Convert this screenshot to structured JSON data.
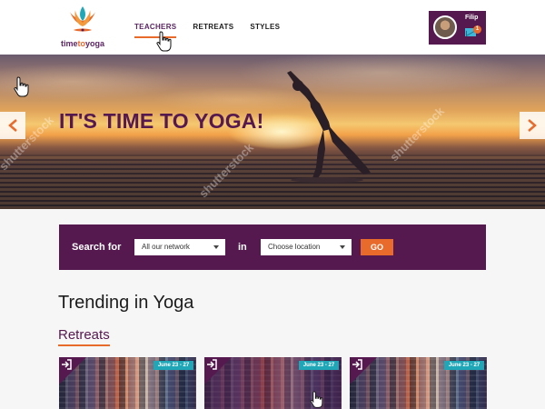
{
  "brand": {
    "logo_text_prefix": "time",
    "logo_text_mid": "to",
    "logo_text_suffix": "yoga",
    "primary_color": "#55194f",
    "accent_color": "#e86b2c",
    "teal_color": "#1fa7b8"
  },
  "nav": {
    "items": [
      {
        "label": "TEACHERS",
        "active": true
      },
      {
        "label": "RETREATS",
        "active": false
      },
      {
        "label": "STYLES",
        "active": false
      }
    ]
  },
  "user": {
    "name": "Filip",
    "mail_count": "1",
    "avatar_icon": "user-avatar",
    "mail_icon": "envelope-icon"
  },
  "hero": {
    "title": "IT'S TIME TO YOGA!",
    "prev_icon": "chevron-left-icon",
    "next_icon": "chevron-right-icon"
  },
  "search": {
    "label": "Search for",
    "network_value": "All our network",
    "in_label": "in",
    "location_placeholder": "Choose location",
    "go_label": "GO"
  },
  "trending": {
    "title": "Trending in Yoga",
    "section_label": "Retreats",
    "cards": [
      {
        "date": "June 23 - 27",
        "icon": "sign-in-icon"
      },
      {
        "date": "June 23 - 27",
        "icon": "sign-in-icon"
      },
      {
        "date": "June 23 - 27",
        "icon": "sign-in-icon"
      }
    ]
  },
  "watermark": "shutterstock"
}
